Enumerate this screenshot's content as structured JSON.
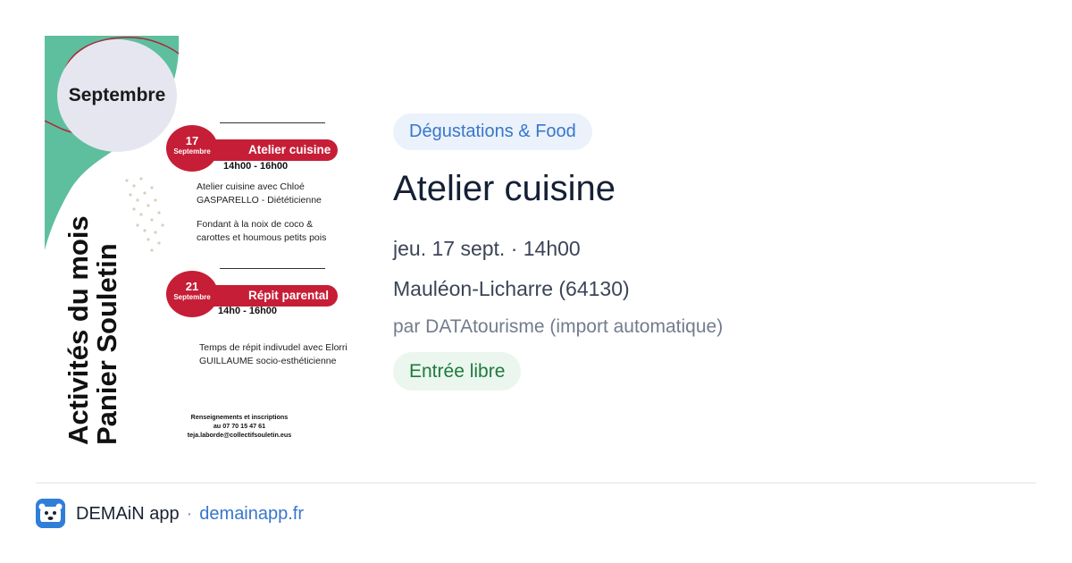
{
  "poster": {
    "month": "Septembre",
    "title_line1": "Activités du mois",
    "title_line2": "Panier Souletin",
    "events": [
      {
        "day": "17",
        "month": "Septembre",
        "name": "Atelier cuisine",
        "time": "14h00 - 16h00",
        "desc1": "Atelier cuisine avec Chloé GASPARELLO - Diététicienne",
        "desc2": "Fondant à la noix de coco & carottes et houmous petits pois"
      },
      {
        "day": "21",
        "month": "Septembre",
        "name": "Répit parental",
        "time": "14h0 - 16h00",
        "desc1": "Temps de répit indivudel avec Elorri GUILLAUME socio-esthéticienne"
      }
    ],
    "contact_title": "Renseignements et inscriptions",
    "contact_phone": "au 07 70 15 47 61",
    "contact_email": "teja.laborde@collectifsouletin.eus"
  },
  "event": {
    "category": "Dégustations & Food",
    "title": "Atelier cuisine",
    "datetime": "jeu. 17 sept. · 14h00",
    "location": "Mauléon-Licharre (64130)",
    "source": "par DATAtourisme (import automatique)",
    "price": "Entrée libre"
  },
  "footer": {
    "app_name": "DEMAiN app",
    "separator": "·",
    "site": "demainapp.fr"
  },
  "colors": {
    "category_bg": "#ebf2fb",
    "category_text": "#3876cc",
    "price_bg": "#eaf6ee",
    "price_text": "#1f7a3d",
    "poster_red": "#c61e36",
    "poster_green": "#5dbf9d",
    "app_icon": "#2f7fd9"
  }
}
